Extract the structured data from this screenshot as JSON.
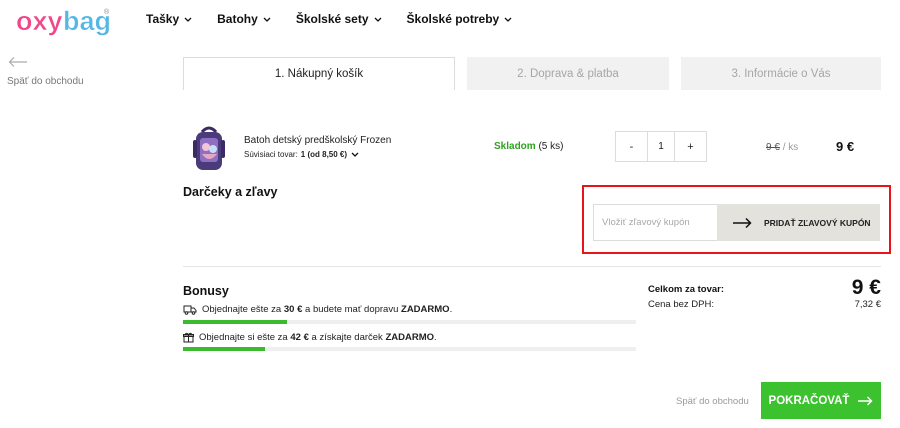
{
  "brand": {
    "logo_text": "oxybag",
    "registered": "®"
  },
  "nav": {
    "items": [
      {
        "label": "Tašky"
      },
      {
        "label": "Batohy"
      },
      {
        "label": "Školské sety"
      },
      {
        "label": "Školské potreby"
      }
    ]
  },
  "back_to_shop_top": "Späť do obchodu",
  "steps": [
    {
      "label": "1. Nákupný košík",
      "active": true
    },
    {
      "label": "2. Doprava & platba",
      "active": false
    },
    {
      "label": "3. Informácie o Vás",
      "active": false
    }
  ],
  "product": {
    "name": "Batoh detský predškolský Frozen",
    "related_label": "Súvisiaci tovar:",
    "related_value": "1 (od 8,50 €)",
    "stock_status": "Skladom",
    "stock_qty": "(5 ks)",
    "quantity": "1",
    "minus": "-",
    "plus": "+",
    "unit_price": "9 €",
    "unit_sep": "/",
    "unit_per": "ks",
    "total": "9 €"
  },
  "gifts": {
    "title": "Darčeky a zľavy",
    "coupon_placeholder": "Vložiť zľavový kupón",
    "coupon_button": "PRIDAŤ ZĽAVOVÝ KUPÓN"
  },
  "bonus": {
    "title": "Bonusy",
    "shipping": {
      "pre": "Objednajte ešte za",
      "amount": "30 €",
      "mid": "a budete mať dopravu",
      "strong": "ZADARMO",
      "post": ".",
      "progress": 0.23
    },
    "gift": {
      "pre": "Objednajte si ešte za",
      "amount": "42 €",
      "mid": "a získajte darček",
      "strong": "ZADARMO",
      "post": ".",
      "progress": 0.18
    }
  },
  "summary": {
    "total_label": "Celkom za tovar:",
    "total_value": "9 €",
    "net_label": "Cena bez DPH:",
    "net_value": "7,32 €"
  },
  "footer": {
    "back_label": "Späť do obchodu",
    "continue_label": "POKRAČOVAŤ"
  },
  "colors": {
    "accent_green": "#3cc12f",
    "stock_green": "#2fa120",
    "highlight_red": "#e8141a",
    "logo_pink": "#f0478b",
    "logo_blue": "#55b7e6"
  }
}
